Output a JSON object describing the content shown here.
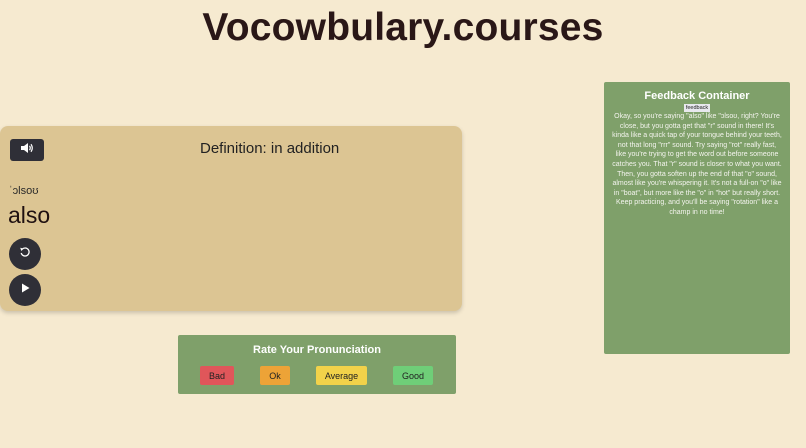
{
  "app": {
    "title": "Vocowbulary.courses"
  },
  "card": {
    "speaker_icon": "speaker-icon",
    "definition": "Definition: in addition",
    "ipa": "ˈɔlsoʊ",
    "word": "also",
    "replay_icon": "replay-icon",
    "play_icon": "play-icon"
  },
  "rating": {
    "title": "Rate Your Pronunciation",
    "buttons": [
      {
        "label": "Bad",
        "color": "#e0565a"
      },
      {
        "label": "Ok",
        "color": "#eda337"
      },
      {
        "label": "Average",
        "color": "#f2d24a"
      },
      {
        "label": "Good",
        "color": "#6fce78"
      }
    ]
  },
  "feedback": {
    "title": "Feedback Container",
    "label": "feedback",
    "text": "Okay, so you're saying \"also\" like \"ɔlsoʊ, right? You're close, but you gotta get that \"r\" sound in there! It's kinda like a quick tap of your tongue behind your teeth, not that long \"rrr\" sound. Try saying \"rot\" really fast, like you're trying to get the word out before someone catches you. That \"r\" sound is closer to what you want. Then, you gotta soften up the end of that \"o\" sound, almost like you're whispering it. It's not a full-on \"o\" like in \"boat\", but more like the \"o\" in \"hot\" but really short. Keep practicing, and you'll be saying \"rotation\" like a champ in no time!"
  },
  "colors": {
    "background": "#f6ead0",
    "card": "#dcc593",
    "panel": "#7fa06a",
    "dark_button": "#2f2f37"
  }
}
